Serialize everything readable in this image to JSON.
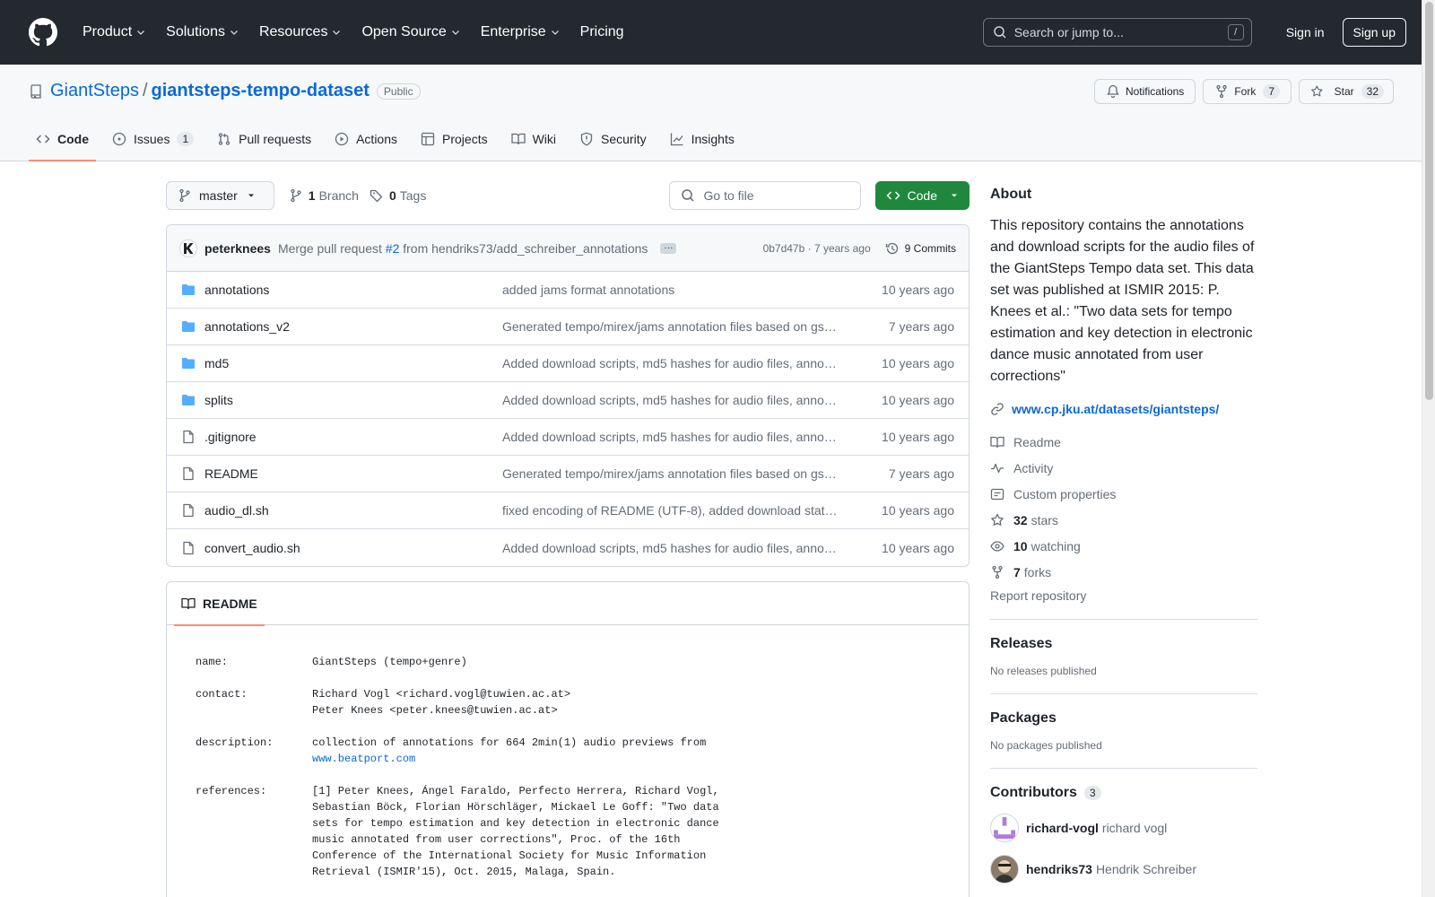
{
  "nav": {
    "items": [
      "Product",
      "Solutions",
      "Resources",
      "Open Source",
      "Enterprise",
      "Pricing"
    ],
    "search_placeholder": "Search or jump to...",
    "search_key": "/",
    "signin": "Sign in",
    "signup": "Sign up"
  },
  "repo": {
    "owner": "GiantSteps",
    "sep": "/",
    "name": "giantsteps-tempo-dataset",
    "visibility": "Public",
    "notifications": "Notifications",
    "fork_label": "Fork",
    "fork_count": "7",
    "star_label": "Star",
    "star_count": "32"
  },
  "tabs": [
    {
      "label": "Code",
      "icon": "code-icon"
    },
    {
      "label": "Issues",
      "icon": "issue-icon",
      "count": "1"
    },
    {
      "label": "Pull requests",
      "icon": "pull-request-icon"
    },
    {
      "label": "Actions",
      "icon": "play-icon"
    },
    {
      "label": "Projects",
      "icon": "table-icon"
    },
    {
      "label": "Wiki",
      "icon": "book-icon"
    },
    {
      "label": "Security",
      "icon": "shield-icon"
    },
    {
      "label": "Insights",
      "icon": "graph-icon"
    }
  ],
  "toolbar": {
    "branch": "master",
    "branch_count": "1",
    "branch_label": "Branch",
    "tag_count": "0",
    "tag_label": "Tags",
    "goto_placeholder": "Go to file",
    "code_label": "Code"
  },
  "commit": {
    "author": "peterknees",
    "msg_prefix": "Merge pull request",
    "pr": "#2",
    "msg_suffix": "from hendriks73/add_schreiber_annotations",
    "sha_time": "0b7d47b · 7 years ago",
    "commits": "9 Commits"
  },
  "files": [
    {
      "name": "annotations",
      "type": "dir",
      "msg": "added jams format annotations",
      "age": "10 years ago"
    },
    {
      "name": "annotations_v2",
      "type": "dir",
      "msg": "Generated tempo/mirex/jams annotation files based on gs_…",
      "age": "7 years ago"
    },
    {
      "name": "md5",
      "type": "dir",
      "msg": "Added download scripts, md5 hashes for audio files, annot…",
      "age": "10 years ago"
    },
    {
      "name": "splits",
      "type": "dir",
      "msg": "Added download scripts, md5 hashes for audio files, annot…",
      "age": "10 years ago"
    },
    {
      "name": ".gitignore",
      "type": "file",
      "msg": "Added download scripts, md5 hashes for audio files, annot…",
      "age": "10 years ago"
    },
    {
      "name": "README",
      "type": "file",
      "msg": "Generated tempo/mirex/jams annotation files based on gs_…",
      "age": "7 years ago"
    },
    {
      "name": "audio_dl.sh",
      "type": "file",
      "msg": "fixed encoding of README (UTF-8), added download stats …",
      "age": "10 years ago"
    },
    {
      "name": "convert_audio.sh",
      "type": "file",
      "msg": "Added download scripts, md5 hashes for audio files, annot…",
      "age": "10 years ago"
    }
  ],
  "readme": {
    "tab": "README",
    "rows": [
      {
        "key": "name:",
        "lines": [
          "GiantSteps (tempo+genre)"
        ]
      },
      {
        "key": "contact:",
        "lines": [
          "Richard Vogl <richard.vogl@tuwien.ac.at>",
          "Peter Knees <peter.knees@tuwien.ac.at>"
        ]
      },
      {
        "key": "description:",
        "lines": [
          "collection of annotations for 664 2min(1) audio previews from"
        ],
        "link": "www.beatport.com"
      },
      {
        "key": "references:",
        "lines": [
          "[1] Peter Knees, Ángel Faraldo, Perfecto Herrera, Richard Vogl,",
          "Sebastian Böck, Florian Hörschläger, Mickael Le Goff: \"Two data",
          "sets for tempo estimation and key detection in electronic dance",
          "music annotated from user corrections\", Proc. of the 16th",
          "Conference of the International Society for Music Information",
          "Retrieval (ISMIR'15), Oct. 2015, Malaga, Spain."
        ]
      }
    ]
  },
  "about": {
    "title": "About",
    "description": "This repository contains the annotations and download scripts for the audio files of the GiantSteps Tempo data set. This data set was published at ISMIR 2015: P. Knees et al.: \"Two data sets for tempo estimation and key detection in electronic dance music annotated from user corrections\"",
    "link": "www.cp.jku.at/datasets/giantsteps/",
    "readme": "Readme",
    "activity": "Activity",
    "custom_properties": "Custom properties",
    "stars_count": "32",
    "stars_label": "stars",
    "watching_count": "10",
    "watching_label": "watching",
    "forks_count": "7",
    "forks_label": "forks",
    "report": "Report repository"
  },
  "releases": {
    "title": "Releases",
    "empty": "No releases published"
  },
  "packages": {
    "title": "Packages",
    "empty": "No packages published"
  },
  "contributors": {
    "title": "Contributors",
    "count": "3",
    "people": [
      {
        "login": "richard-vogl",
        "name": "richard vogl"
      },
      {
        "login": "hendriks73",
        "name": "Hendrik Schreiber"
      }
    ]
  }
}
